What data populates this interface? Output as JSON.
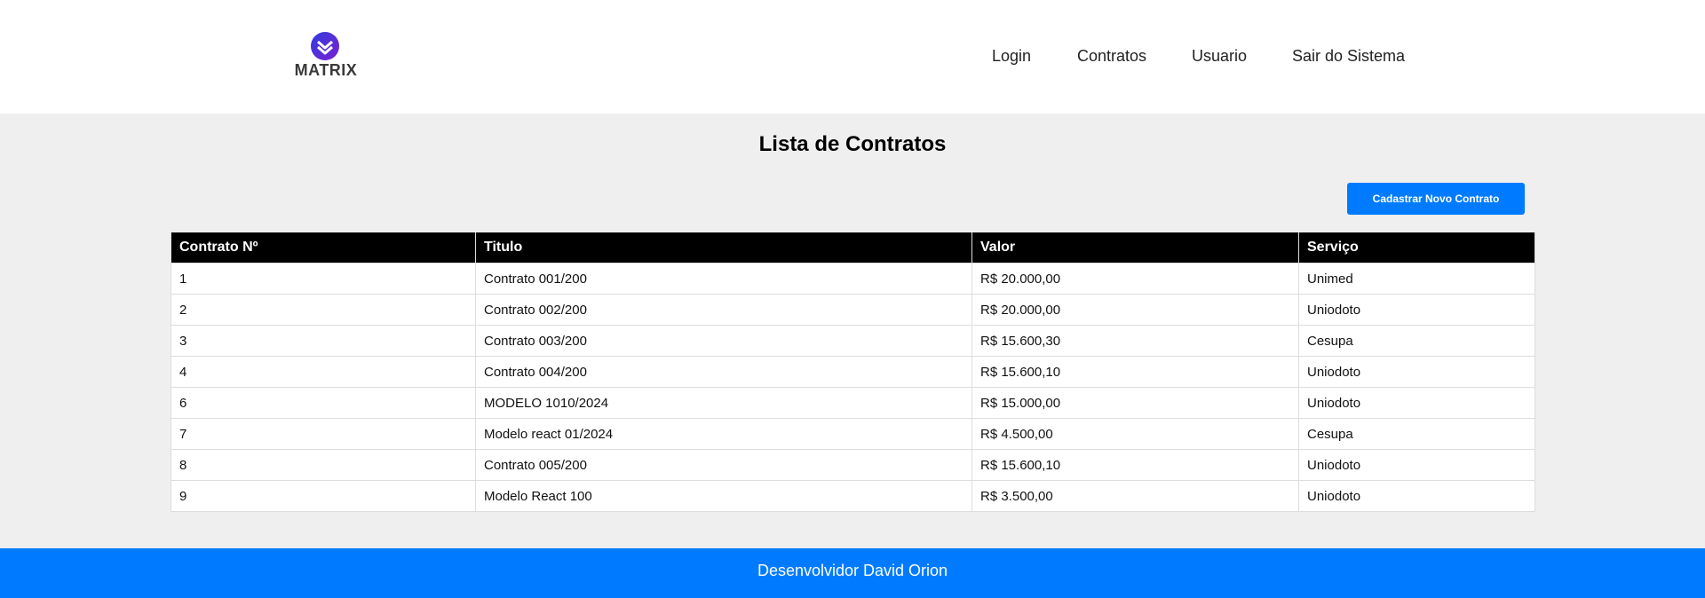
{
  "header": {
    "logo_text": "MATRIX",
    "nav": {
      "login": "Login",
      "contratos": "Contratos",
      "usuario": "Usuario",
      "sair": "Sair do Sistema"
    }
  },
  "main": {
    "title": "Lista de Contratos",
    "new_button": "Cadastrar Novo Contrato",
    "table": {
      "headers": [
        "Contrato Nº",
        "Titulo",
        "Valor",
        "Serviço"
      ],
      "rows": [
        [
          "1",
          "Contrato 001/200",
          "R$ 20.000,00",
          "Unimed"
        ],
        [
          "2",
          "Contrato 002/200",
          "R$ 20.000,00",
          "Uniodoto"
        ],
        [
          "3",
          "Contrato 003/200",
          "R$ 15.600,30",
          "Cesupa"
        ],
        [
          "4",
          "Contrato 004/200",
          "R$ 15.600,10",
          "Uniodoto"
        ],
        [
          "6",
          "MODELO 1010/2024",
          "R$ 15.000,00",
          "Uniodoto"
        ],
        [
          "7",
          "Modelo react 01/2024",
          "R$ 4.500,00",
          "Cesupa"
        ],
        [
          "8",
          "Contrato 005/200",
          "R$ 15.600,10",
          "Uniodoto"
        ],
        [
          "9",
          "Modelo React 100",
          "R$ 3.500,00",
          "Uniodoto"
        ]
      ]
    }
  },
  "footer": {
    "text": "Desenvolvidor David Orion"
  },
  "colors": {
    "accent": "#007bff",
    "header_bg": "#ffffff",
    "page_bg": "#efefef",
    "table_header_bg": "#000000",
    "logo_gradient_start": "#3d3ad8",
    "logo_gradient_end": "#7a1fd1"
  },
  "icons": {
    "logo_mark": "matrix-chevron-logo"
  }
}
